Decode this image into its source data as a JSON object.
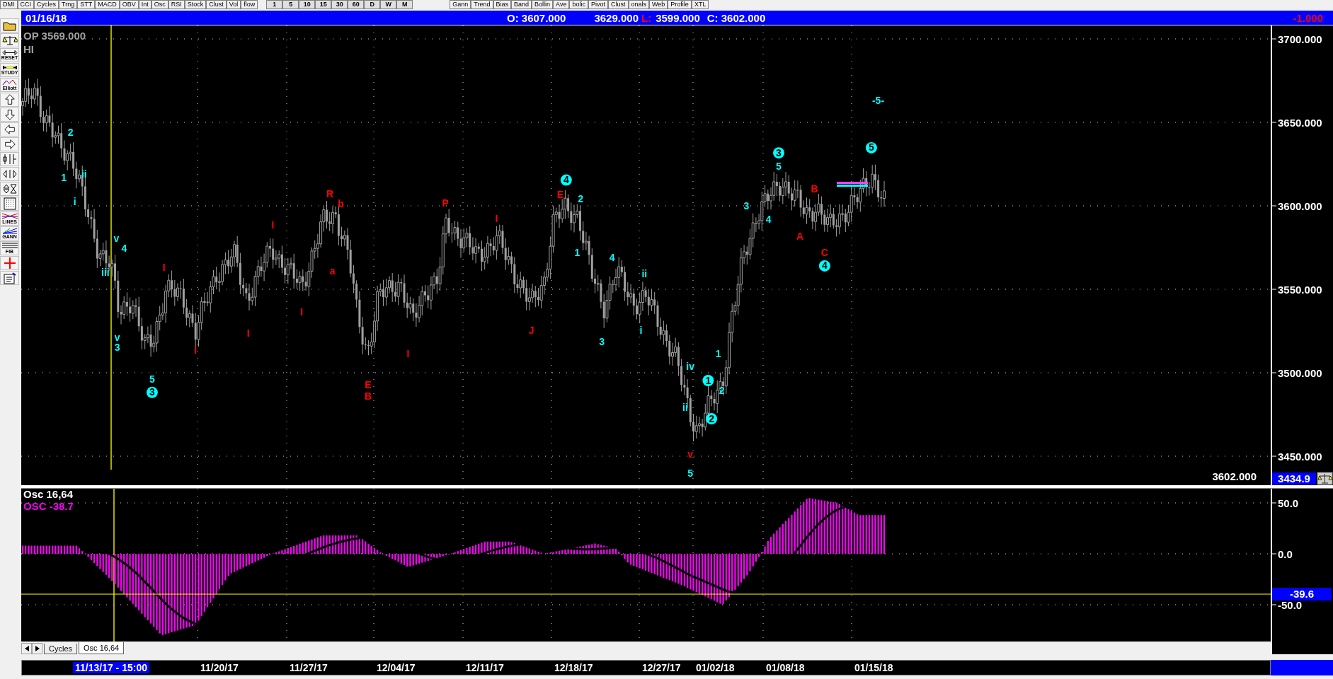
{
  "top_toolbar": {
    "indicator_buttons": [
      "DMI",
      "CCI",
      "Cycles",
      "Trng",
      "STT",
      "MACD",
      "OBV",
      "Int",
      "Osc",
      "RSI",
      "Stock",
      "Clust",
      "Vol",
      "flow"
    ],
    "period_buttons": [
      "1",
      "5",
      "10",
      "15",
      "30",
      "60",
      "D",
      "W",
      "M"
    ],
    "study_buttons": [
      "Gann",
      "Trend",
      "Bias",
      "Band",
      "Bollin",
      "Ave",
      "bolic",
      "Pivot",
      "Clust",
      "onals",
      "Web",
      "Profile",
      "XTL"
    ]
  },
  "left_toolbar": {
    "labels": [
      "RESET",
      "STUDY",
      "Elliott",
      "LINES",
      "GANN",
      "FIB"
    ]
  },
  "header": {
    "date": "01/16/18",
    "open": "O: 3607.000",
    "high": "3629.000",
    "low_label": "L:",
    "low": "3599.000",
    "close": "C: 3602.000",
    "change": "-1.000"
  },
  "price_panel": {
    "open_label": "OP  3569.000",
    "hi_label": "HI",
    "last_price": "3602.000",
    "axis_labels": [
      "3700.000",
      "3650.000",
      "3600.000",
      "3550.000",
      "3500.000",
      "3450.000"
    ],
    "cursor_value": "3434.9",
    "wave_labels": [
      {
        "text": "2",
        "color": "#00ffff",
        "kind": "plain"
      },
      {
        "text": "1",
        "color": "#00ffff",
        "kind": "plain"
      },
      {
        "text": "ii",
        "color": "#00ffff",
        "kind": "plain"
      },
      {
        "text": "i",
        "color": "#00ffff",
        "kind": "plain"
      },
      {
        "text": "v",
        "color": "#00ffff",
        "kind": "plain"
      },
      {
        "text": "4",
        "color": "#00ffff",
        "kind": "plain"
      },
      {
        "text": "iii",
        "color": "#00ffff",
        "kind": "plain"
      },
      {
        "text": "v",
        "color": "#00ffff",
        "kind": "plain"
      },
      {
        "text": "3",
        "color": "#00ffff",
        "kind": "plain"
      },
      {
        "text": "5",
        "color": "#00ffff",
        "kind": "plain"
      },
      {
        "text": "3",
        "color": "#00ffff",
        "kind": "circled"
      },
      {
        "text": "I",
        "color": "#ff0000",
        "kind": "plain"
      },
      {
        "text": "I",
        "color": "#ff0000",
        "kind": "plain"
      },
      {
        "text": "I",
        "color": "#ff0000",
        "kind": "plain"
      },
      {
        "text": "I",
        "color": "#ff0000",
        "kind": "plain"
      },
      {
        "text": "I",
        "color": "#ff0000",
        "kind": "plain"
      },
      {
        "text": "R",
        "color": "#ff0000",
        "kind": "plain"
      },
      {
        "text": "b",
        "color": "#ff0000",
        "kind": "plain"
      },
      {
        "text": "a",
        "color": "#ff0000",
        "kind": "plain"
      },
      {
        "text": "E",
        "color": "#ff0000",
        "kind": "plain"
      },
      {
        "text": "B",
        "color": "#ff0000",
        "kind": "plain"
      },
      {
        "text": "I",
        "color": "#ff0000",
        "kind": "plain"
      },
      {
        "text": "P",
        "color": "#ff0000",
        "kind": "plain"
      },
      {
        "text": "I",
        "color": "#ff0000",
        "kind": "plain"
      },
      {
        "text": "J",
        "color": "#ff0000",
        "kind": "plain"
      },
      {
        "text": "4",
        "color": "#00ffff",
        "kind": "circled"
      },
      {
        "text": "E",
        "color": "#ff0000",
        "kind": "plain"
      },
      {
        "text": "2",
        "color": "#00ffff",
        "kind": "plain"
      },
      {
        "text": "1",
        "color": "#00ffff",
        "kind": "plain"
      },
      {
        "text": "4",
        "color": "#00ffff",
        "kind": "plain"
      },
      {
        "text": "3",
        "color": "#00ffff",
        "kind": "plain"
      },
      {
        "text": "ii",
        "color": "#00ffff",
        "kind": "plain"
      },
      {
        "text": "i",
        "color": "#00ffff",
        "kind": "plain"
      },
      {
        "text": "iv",
        "color": "#00ffff",
        "kind": "plain"
      },
      {
        "text": "1",
        "color": "#00ffff",
        "kind": "plain"
      },
      {
        "text": "1",
        "color": "#00ffff",
        "kind": "circled"
      },
      {
        "text": "2",
        "color": "#00ffff",
        "kind": "plain"
      },
      {
        "text": "ii",
        "color": "#00ffff",
        "kind": "plain"
      },
      {
        "text": "2",
        "color": "#00ffff",
        "kind": "circled"
      },
      {
        "text": "v",
        "color": "#ff0000",
        "kind": "plain"
      },
      {
        "text": "5",
        "color": "#00ffff",
        "kind": "plain"
      },
      {
        "text": "3",
        "color": "#00ffff",
        "kind": "plain"
      },
      {
        "text": "4",
        "color": "#00ffff",
        "kind": "plain"
      },
      {
        "text": "3",
        "color": "#00ffff",
        "kind": "circled"
      },
      {
        "text": "5",
        "color": "#00ffff",
        "kind": "plain"
      },
      {
        "text": "B",
        "color": "#ff0000",
        "kind": "plain"
      },
      {
        "text": "A",
        "color": "#ff0000",
        "kind": "plain"
      },
      {
        "text": "C",
        "color": "#ff0000",
        "kind": "plain"
      },
      {
        "text": "4",
        "color": "#00ffff",
        "kind": "circled"
      },
      {
        "text": "5",
        "color": "#00ffff",
        "kind": "circled"
      },
      {
        "text": "-5-",
        "color": "#00ffff",
        "kind": "plain"
      }
    ]
  },
  "oscillator_panel": {
    "title": "Osc 16,64",
    "value_label": "OSC -38.7",
    "axis_labels": [
      "50.0",
      "0.0",
      "-50.0"
    ],
    "cursor_value": "-39.6"
  },
  "tabs": [
    {
      "label": "Cycles",
      "selected": false
    },
    {
      "label": "Osc 16,64",
      "selected": true
    }
  ],
  "date_axis": [
    {
      "label": "11/13/17 - 15:00",
      "selected": true
    },
    {
      "label": "11/20/17",
      "selected": false
    },
    {
      "label": "11/27/17",
      "selected": false
    },
    {
      "label": "12/04/17",
      "selected": false
    },
    {
      "label": "12/11/17",
      "selected": false
    },
    {
      "label": "12/18/17",
      "selected": false
    },
    {
      "label": "12/27/17",
      "selected": false
    },
    {
      "label": "01/02/18",
      "selected": false
    },
    {
      "label": "01/08/18",
      "selected": false
    },
    {
      "label": "01/15/18",
      "selected": false
    }
  ]
}
